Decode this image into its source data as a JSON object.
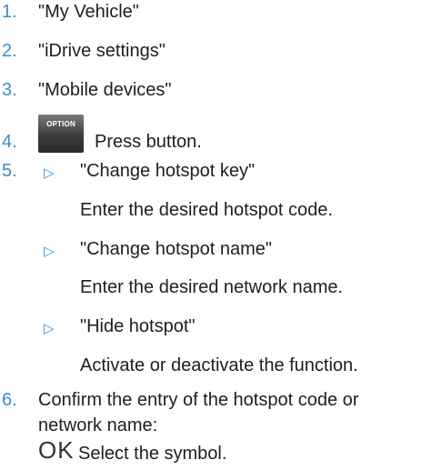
{
  "steps": [
    {
      "num": "1.",
      "text": "\"My Vehicle\""
    },
    {
      "num": "2.",
      "text": "\"iDrive settings\""
    },
    {
      "num": "3.",
      "text": "\"Mobile devices\""
    },
    {
      "num": "4.",
      "text": "Press button.",
      "button_label": "OPTION"
    },
    {
      "num": "5."
    },
    {
      "num": "6.",
      "text_line1": "Confirm the entry of the hotspot code or",
      "text_line2": "network name:",
      "symbol": "OK",
      "symbol_text": "Select the symbol."
    }
  ],
  "substeps": [
    {
      "title": "\"Change hotspot key\"",
      "detail": "Enter the desired hotspot code."
    },
    {
      "title": "\"Change hotspot name\"",
      "detail": "Enter the desired network name."
    },
    {
      "title": "\"Hide hotspot\"",
      "detail": "Activate or deactivate the function."
    }
  ],
  "bullet_icon": "triangle-right-outline-icon",
  "accent_color": "#3a8ec9"
}
